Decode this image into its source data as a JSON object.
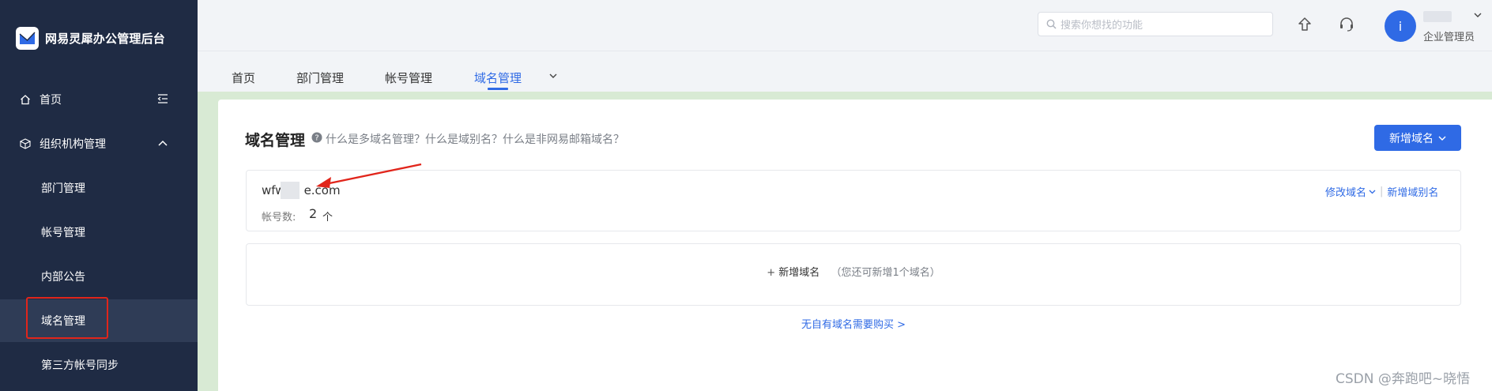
{
  "app": {
    "title": "网易灵犀办公管理后台"
  },
  "sidebar": {
    "items": [
      {
        "label": "首页",
        "icon": "home-icon"
      },
      {
        "label": "组织机构管理",
        "icon": "cube-icon"
      },
      {
        "label": "部门管理"
      },
      {
        "label": "帐号管理"
      },
      {
        "label": "内部公告"
      },
      {
        "label": "域名管理",
        "active": true
      },
      {
        "label": "第三方帐号同步"
      }
    ]
  },
  "header": {
    "search_placeholder": "搜索你想找的功能",
    "avatar_letter": "i",
    "user_role": "企业管理员"
  },
  "tabs": [
    {
      "label": "首页"
    },
    {
      "label": "部门管理"
    },
    {
      "label": "帐号管理"
    },
    {
      "label": "域名管理",
      "active": true
    }
  ],
  "main": {
    "title": "域名管理",
    "help_text": "什么是多域名管理？什么是域别名？什么是非网易邮箱域名？",
    "add_button": "新增域名",
    "domain": {
      "name_prefix": "wfw",
      "name_suffix": "e.com",
      "account_label": "帐号数:",
      "account_count": "2",
      "account_unit": "个",
      "modify_label": "修改域名",
      "alias_label": "新增域别名"
    },
    "add_box": {
      "plus": "+",
      "label": "新增域名",
      "note": "（您还可新增1个域名）"
    },
    "buy_link": "无自有域名需要购买 >"
  },
  "watermark": "CSDN @奔跑吧~晓悟",
  "colors": {
    "sidebar_bg": "#1f2b44",
    "accent": "#2f6ae5",
    "highlight": "#e1251b"
  }
}
